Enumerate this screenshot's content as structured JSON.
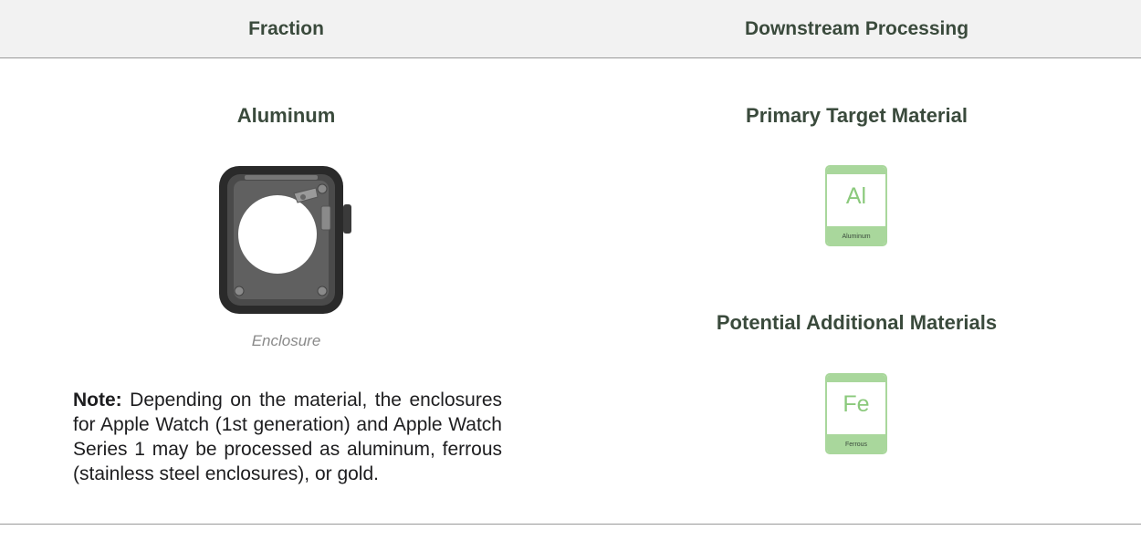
{
  "header": {
    "fraction": "Fraction",
    "downstream": "Downstream Processing"
  },
  "fraction": {
    "name": "Aluminum",
    "image_caption": "Enclosure",
    "note_label": "Note:",
    "note_text": " Depending on the material, the enclosures for Apple Watch (1st generation) and Apple Watch Series 1 may be processed as aluminum, ferrous (stainless steel enclosures), or gold."
  },
  "downstream": {
    "primary_title": "Primary Target Material",
    "primary": {
      "symbol": "Al",
      "name": "Aluminum"
    },
    "additional_title": "Potential Additional Materials",
    "additional": {
      "symbol": "Fe",
      "name": "Ferrous"
    }
  },
  "colors": {
    "tile_green": "#a9d79c",
    "symbol_green": "#8bc97c",
    "heading": "#3a4a3c",
    "header_bg": "#f2f2f2"
  }
}
